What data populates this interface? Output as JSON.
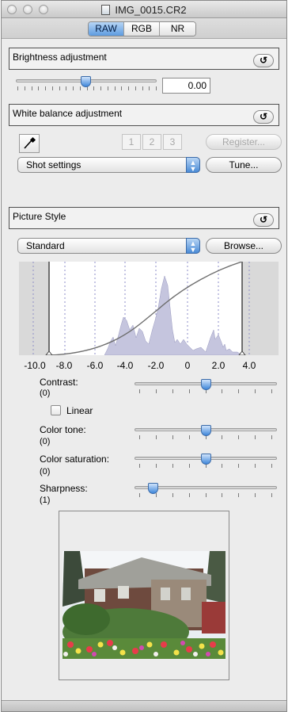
{
  "window": {
    "title": "IMG_0015.CR2"
  },
  "tabs": [
    {
      "label": "RAW",
      "active": true
    },
    {
      "label": "RGB",
      "active": false
    },
    {
      "label": "NR",
      "active": false
    }
  ],
  "brightness": {
    "header": "Brightness adjustment",
    "reset_label": "↺",
    "value": "0.00"
  },
  "white_balance": {
    "header": "White balance adjustment",
    "reset_label": "↺",
    "presets": [
      "1",
      "2",
      "3"
    ],
    "register_label": "Register...",
    "setting_value": "Shot settings",
    "tune_label": "Tune..."
  },
  "picture_style": {
    "header": "Picture Style",
    "reset_label": "↺",
    "style_value": "Standard",
    "browse_label": "Browse...",
    "histogram_ticks": [
      "-10.0",
      "-8.0",
      "-6.0",
      "-4.0",
      "-2.0",
      "0",
      "2.0",
      "4.0"
    ],
    "contrast": {
      "label": "Contrast:",
      "value": "(0)"
    },
    "linear": {
      "label": "Linear",
      "checked": false
    },
    "color_tone": {
      "label": "Color tone:",
      "value": "(0)"
    },
    "color_saturation": {
      "label": "Color saturation:",
      "value": "(0)"
    },
    "sharpness": {
      "label": "Sharpness:",
      "value": "(1)"
    }
  },
  "colors": {
    "accent": "#4a8bd6",
    "histogram_fill": "#c5c5de"
  }
}
